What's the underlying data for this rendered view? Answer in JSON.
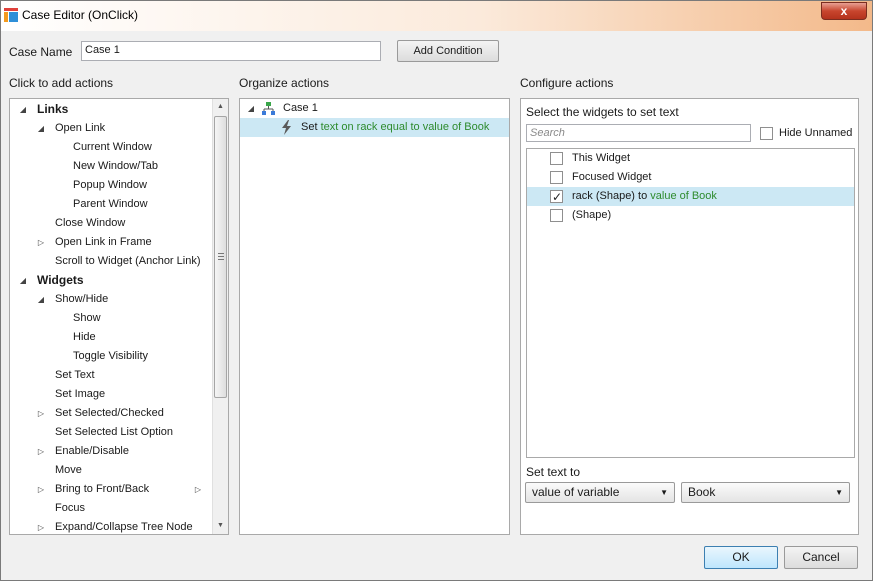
{
  "window": {
    "title": "Case Editor (OnClick)",
    "close_glyph": "x"
  },
  "case_name": {
    "label": "Case Name",
    "value": "Case 1",
    "add_condition": "Add Condition"
  },
  "sections": {
    "left": "Click to add actions",
    "middle": "Organize actions",
    "right": "Configure actions"
  },
  "actions_tree": [
    {
      "label": "Links",
      "bold": true,
      "arrow": "down",
      "indent": 0
    },
    {
      "label": "Open Link",
      "arrow": "down",
      "indent": 1
    },
    {
      "label": "Current Window",
      "indent": 2
    },
    {
      "label": "New Window/Tab",
      "indent": 2
    },
    {
      "label": "Popup Window",
      "indent": 2
    },
    {
      "label": "Parent Window",
      "indent": 2
    },
    {
      "label": "Close Window",
      "indent": 1
    },
    {
      "label": "Open Link in Frame",
      "arrow": "right",
      "indent": 1
    },
    {
      "label": "Scroll to Widget (Anchor Link)",
      "indent": 1
    },
    {
      "label": "Widgets",
      "bold": true,
      "arrow": "down",
      "indent": 0
    },
    {
      "label": "Show/Hide",
      "arrow": "down",
      "indent": 1
    },
    {
      "label": "Show",
      "indent": 2
    },
    {
      "label": "Hide",
      "indent": 2
    },
    {
      "label": "Toggle Visibility",
      "indent": 2
    },
    {
      "label": "Set Text",
      "indent": 1
    },
    {
      "label": "Set Image",
      "indent": 1
    },
    {
      "label": "Set Selected/Checked",
      "arrow": "right",
      "indent": 1
    },
    {
      "label": "Set Selected List Option",
      "indent": 1
    },
    {
      "label": "Enable/Disable",
      "arrow": "right",
      "indent": 1
    },
    {
      "label": "Move",
      "indent": 1
    },
    {
      "label": "Bring to Front/Back",
      "arrow": "right",
      "indent": 1,
      "right_arrow": true
    },
    {
      "label": "Focus",
      "indent": 1
    },
    {
      "label": "Expand/Collapse Tree Node",
      "arrow": "right",
      "indent": 1
    }
  ],
  "organize": {
    "case_label": "Case 1",
    "action_prefix": "Set ",
    "action_text": "text on rack equal to value of Book"
  },
  "configure": {
    "heading": "Select the widgets to set text",
    "search_placeholder": "Search",
    "hide_unnamed": "Hide Unnamed",
    "widgets": [
      {
        "label": "This Widget",
        "checked": false
      },
      {
        "label": "Focused Widget",
        "checked": false
      },
      {
        "label": "rack (Shape) to ",
        "suffix": "value of Book",
        "checked": true
      },
      {
        "label": "(Shape)",
        "checked": false
      }
    ],
    "set_text_label": "Set text to",
    "select_type": "value of variable",
    "select_value": "Book"
  },
  "footer": {
    "ok": "OK",
    "cancel": "Cancel"
  },
  "colors": {
    "selection": "#cce8f4",
    "green_text": "#2e8b2e"
  }
}
